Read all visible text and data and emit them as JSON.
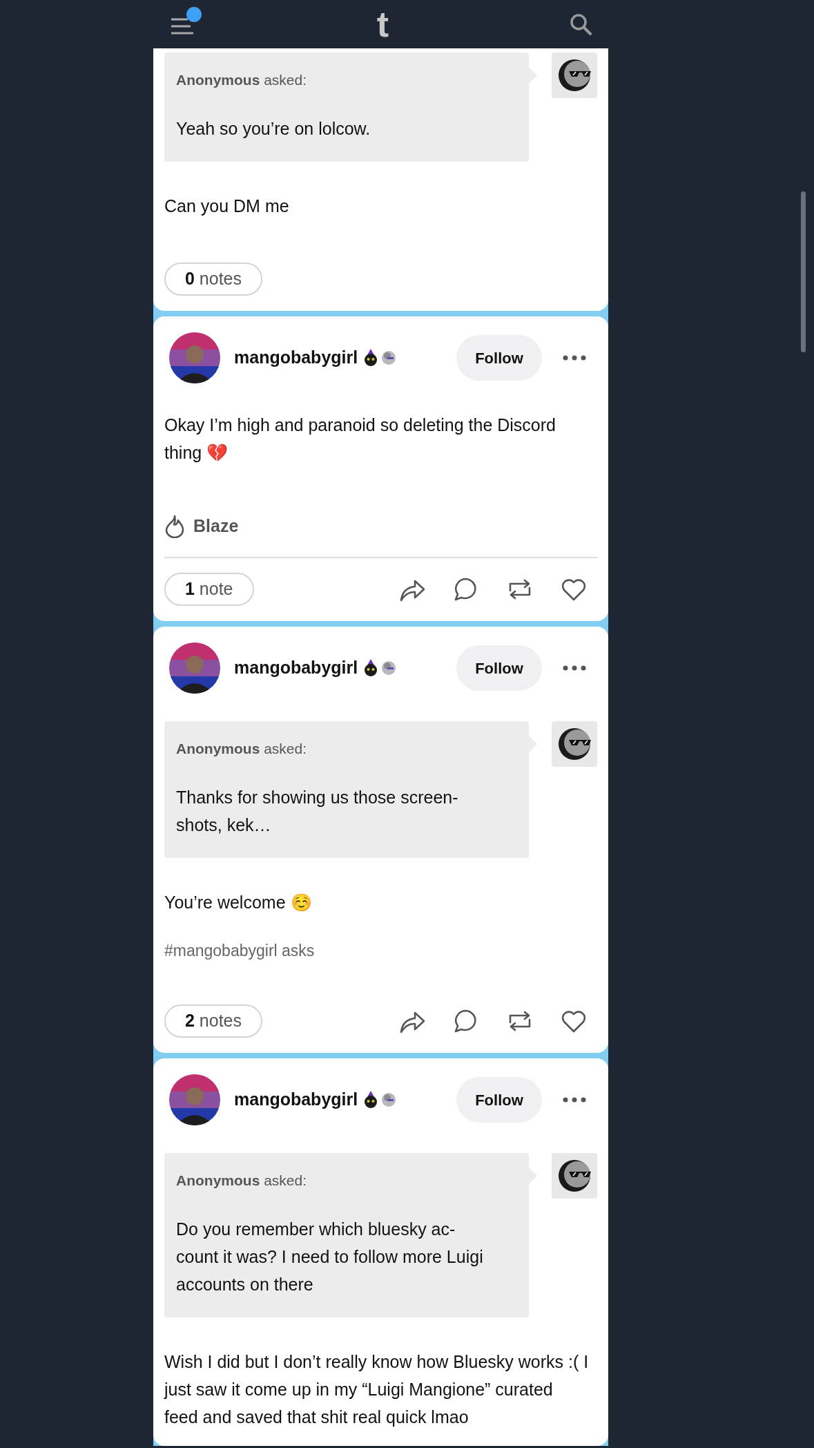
{
  "top_bar": {
    "logo": "t",
    "notification_dot": true
  },
  "posts": [
    {
      "ask": {
        "asker": "Anonymous",
        "verb": "asked:",
        "lines": [
          "Yeah so you’re on lolcow."
        ]
      },
      "body": [
        "Can you DM me"
      ],
      "notes": {
        "count": "0",
        "label": "notes"
      },
      "actions": false
    },
    {
      "author": {
        "name": "mangobabygirl",
        "follow": "Follow"
      },
      "body": [
        "Okay I’m high and paranoid so deleting the Discord thing 💔"
      ],
      "blaze": "Blaze",
      "notes": {
        "count": "1",
        "label": "note"
      },
      "actions": true
    },
    {
      "author": {
        "name": "mangobabygirl",
        "follow": "Follow"
      },
      "ask": {
        "asker": "Anonymous",
        "verb": "asked:",
        "lines": [
          "Thanks for showing us those screen-",
          "shots, kek…"
        ]
      },
      "body": [
        "You’re welcome ☺️"
      ],
      "tags": [
        "#mangobabygirl asks"
      ],
      "notes": {
        "count": "2",
        "label": "notes"
      },
      "actions": true
    },
    {
      "author": {
        "name": "mangobabygirl",
        "follow": "Follow"
      },
      "ask": {
        "asker": "Anonymous",
        "verb": "asked:",
        "lines": [
          "Do you remember which bluesky ac-",
          "count it was? I need to follow more Luigi",
          "accounts on there"
        ]
      },
      "body": [
        "Wish I did but I don’t really know how Bluesky works :( I just saw it come up in my “Luigi Mangione” curated feed and saved that shit real quick lmao"
      ]
    }
  ]
}
